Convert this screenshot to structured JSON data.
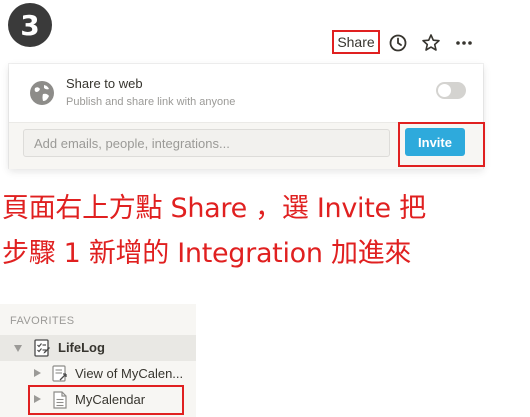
{
  "step_badge": "3",
  "topbar": {
    "share_label": "Share",
    "icons": [
      "history-icon",
      "star-icon",
      "more-icon"
    ]
  },
  "share_panel": {
    "share_to_web_title": "Share to web",
    "share_to_web_subtitle": "Publish and share link with anyone",
    "share_to_web_enabled": false,
    "invite_placeholder": "Add emails, people, integrations...",
    "invite_button": "Invite"
  },
  "instruction": {
    "line1": "頁面右上方點 Share ，選 Invite 把",
    "line2": "步驟 1 新增的 Integration 加進來"
  },
  "sidebar": {
    "header": "FAVORITES",
    "items": [
      {
        "label": "LifeLog",
        "icon": "checklist-page-icon",
        "expanded": true,
        "selected": true
      },
      {
        "label": "View of MyCalen...",
        "icon": "linked-view-page-icon",
        "expanded": false
      },
      {
        "label": "MyCalendar",
        "icon": "page-icon",
        "expanded": false
      }
    ]
  },
  "colors": {
    "annotation": "#e02020",
    "invite_button": "#2eaadc",
    "badge": "#3a3a3a"
  }
}
